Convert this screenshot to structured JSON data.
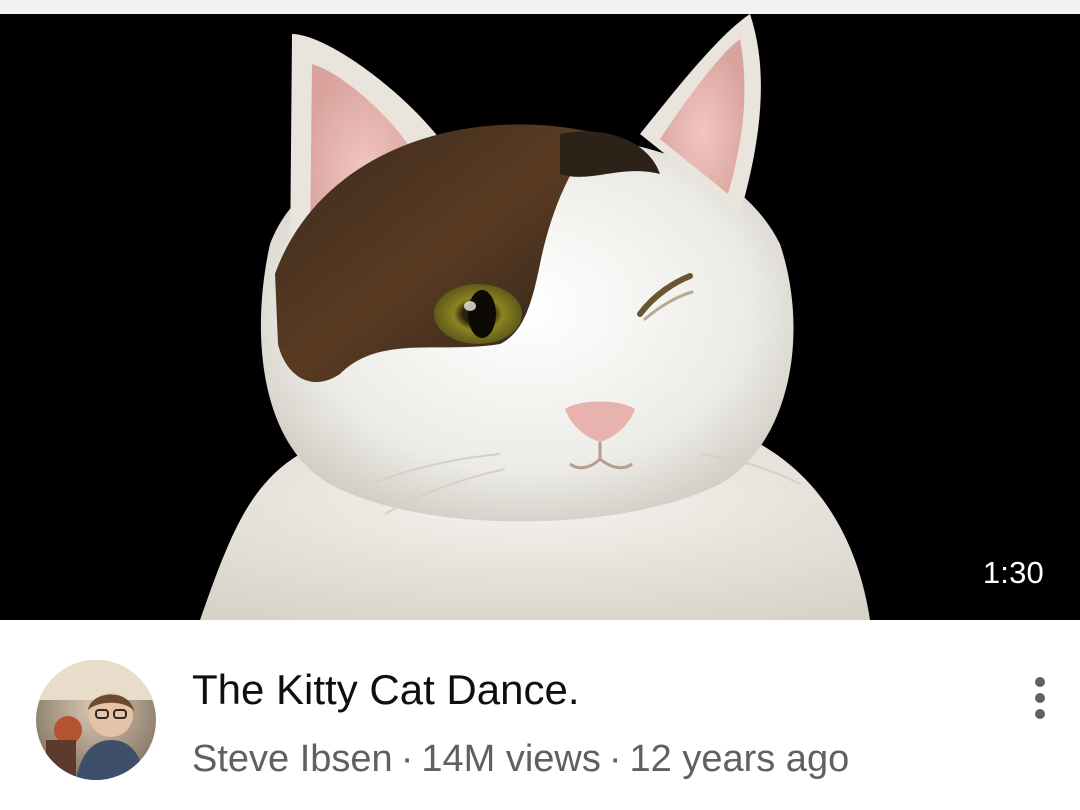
{
  "video": {
    "duration": "1:30",
    "title": "The Kitty Cat Dance.",
    "channel": "Steve Ibsen",
    "views": "14M views",
    "age": "12 years ago",
    "separator": "·"
  },
  "icons": {
    "more": "more-vert-icon",
    "avatar": "channel-avatar"
  },
  "colors": {
    "thumbnail_bg": "#000000",
    "title_text": "#0f0f0f",
    "meta_text": "#606060",
    "duration_text": "#ffffff"
  }
}
